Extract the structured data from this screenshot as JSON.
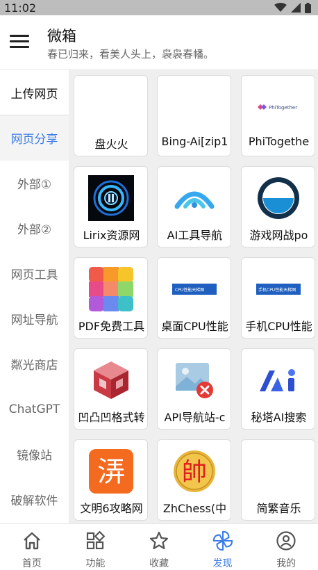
{
  "status_bar": {
    "time": "11:02",
    "icons": [
      "wifi-icon",
      "signal-icon",
      "battery-icon"
    ]
  },
  "header": {
    "title": "微箱",
    "subtitle": "春已归来，看美人头上，袅袅春幡。"
  },
  "sidebar": {
    "items": [
      {
        "label": "上传网页",
        "state": "normal"
      },
      {
        "label": "网页分享",
        "state": "selected"
      },
      {
        "label": "外部①",
        "state": "normal"
      },
      {
        "label": "外部②",
        "state": "normal"
      },
      {
        "label": "网页工具",
        "state": "normal"
      },
      {
        "label": "网址导航",
        "state": "normal"
      },
      {
        "label": "粼光商店",
        "state": "normal"
      },
      {
        "label": "ChatGPT",
        "state": "normal"
      },
      {
        "label": "镜像站",
        "state": "normal"
      },
      {
        "label": "破解软件",
        "state": "normal"
      }
    ]
  },
  "cards": [
    {
      "label": "盘火火",
      "icon": "blank"
    },
    {
      "label": "Bing-Ai[zip1",
      "icon": "blank"
    },
    {
      "label": "PhiTogethe",
      "icon": "phitogether-logo",
      "logo_text": "PhiTogether"
    },
    {
      "label": "Lirix资源网",
      "icon": "lirix-logo"
    },
    {
      "label": "AI工具导航",
      "icon": "ai-nav-logo"
    },
    {
      "label": "游戏网战po",
      "icon": "game-logo"
    },
    {
      "label": "PDF免费工具",
      "icon": "pdf-grid-logo"
    },
    {
      "label": "桌面CPU性能",
      "icon": "cpu-banner",
      "logo_text": "CPU性能天梯图"
    },
    {
      "label": "手机CPU性能",
      "icon": "cpu-banner",
      "logo_text": "手机CPU性能天梯图"
    },
    {
      "label": "凹凸凹格式转",
      "icon": "cube-logo"
    },
    {
      "label": "API导航站-c",
      "icon": "broken-image-icon"
    },
    {
      "label": "秘塔AI搜索",
      "icon": "metaso-logo"
    },
    {
      "label": "文明6攻略网",
      "icon": "civ-logo",
      "logo_text": "㳥"
    },
    {
      "label": "ZhChess(中",
      "icon": "chess-logo",
      "logo_text": "帥"
    },
    {
      "label": "简繁音乐",
      "icon": "blank"
    }
  ],
  "bottom_nav": {
    "items": [
      {
        "label": "首页",
        "icon": "home-icon"
      },
      {
        "label": "功能",
        "icon": "grid-icon"
      },
      {
        "label": "收藏",
        "icon": "star-icon"
      },
      {
        "label": "发现",
        "icon": "pinwheel-icon",
        "active": true
      },
      {
        "label": "我的",
        "icon": "profile-icon"
      }
    ]
  },
  "colors": {
    "accent": "#3b7de9",
    "status_bar": "#bdbdbd",
    "grid_bg": "#efefef"
  }
}
